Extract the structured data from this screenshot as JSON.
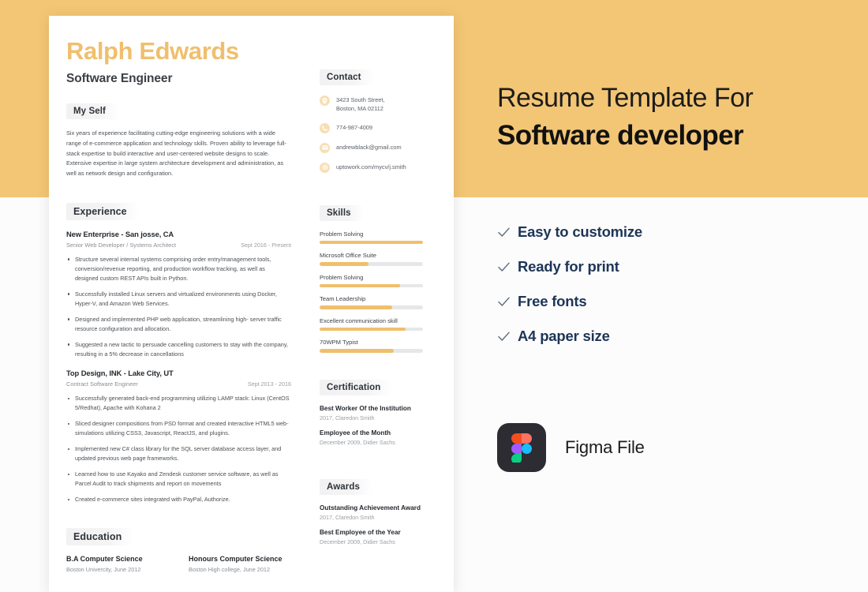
{
  "resume": {
    "name": "Ralph Edwards",
    "job_title": "Software Engineer",
    "sections": {
      "myself": "My Self",
      "experience": "Experience",
      "education": "Education",
      "contact": "Contact",
      "skills": "Skills",
      "certification": "Certification",
      "awards": "Awards"
    },
    "summary": "Six years of experience facilitating cutting-edge engineering solutions with a wide range of e-commerce application and technology skills. Proven ability to leverage full-stack expertise to build interactive and user-centered website designs to scale. Extensive expertise in large system architecture development and administration, as well as network design and configuration.",
    "jobs": [
      {
        "title": "New Enterprise - San josse, CA",
        "role": "Senior Web Developer / Systems Architect",
        "date": "Sept 2016 - Present",
        "bullets": [
          "Structure several internal systems comprising order entry/management tools, conversion/revenue reporting, and production workflow tracking, as well as designed custom REST APIs built in Python.",
          "Successfully installed Linux servers and virtualized environments using Docker, Hyper-V, and Amazon Web Services.",
          "Designed and implemented PHP web application, streamlining high- server traffic resource configuration and allocation.",
          "Suggested a new tactic to persuade cancelling customers to stay with the company, resulting in a 5% decrease in cancellations"
        ]
      },
      {
        "title": "Top Design, INK - Lake City, UT",
        "role": "Contract Software Engineer",
        "date": "Sept 2013 - 2016",
        "bullets": [
          "Successfully generated back-end programming utilizing LAMP stack: Linux (CentOS 5/Redhat), Apache with Kohana 2",
          "Sliced designer compositions from PSD format and created interactive HTML5 web-simulations utilizing CSS3, Javascript, ReactJS, and plugins.",
          "Implemented new C# class library for the SQL server database access layer, and updated previous web page frameworks.",
          "Learned how to use Kayako and Zendesk customer service software, as well as Parcel Audit to track shipments and report on movements",
          "Created e-commerce sites integrated with PayPal, Authorize."
        ]
      }
    ],
    "education": [
      {
        "degree": "B.A Computer Science",
        "sub": "Boston Univercity, June 2012"
      },
      {
        "degree": "Honours Computer Science",
        "sub": "Boston High college, June 2012"
      }
    ],
    "contact": [
      {
        "icon": "location-pin-icon",
        "text": "3423 South Street,\nBoston, MA 02112"
      },
      {
        "icon": "phone-icon",
        "text": "774-987-4009"
      },
      {
        "icon": "envelope-icon",
        "text": "andrewblack@gmail.com"
      },
      {
        "icon": "globe-icon",
        "text": "uptowork.com/mycv/j.smith"
      }
    ],
    "skills": [
      {
        "name": "Problem Solving",
        "level": 100
      },
      {
        "name": "Microsoft Office Suite",
        "level": 47
      },
      {
        "name": "Problem Solving",
        "level": 78
      },
      {
        "name": "Team Leadership",
        "level": 70
      },
      {
        "name": "Excellent communication skill",
        "level": 83
      },
      {
        "name": "70WPM Typist",
        "level": 72
      }
    ],
    "certifications": [
      {
        "title": "Best Worker Of the Institution",
        "sub": "2017, Claredon Smith"
      },
      {
        "title": "Employee of the Month",
        "sub": "December 2009, Didier Sachs"
      }
    ],
    "awards": [
      {
        "title": "Outstanding Achievement Award",
        "sub": "2017, Claredon Smith"
      },
      {
        "title": "Best Employee of the Year",
        "sub": "December 2009, Didier Sachs"
      }
    ]
  },
  "promo": {
    "title_line1": "Resume Template For",
    "title_line2": "Software developer",
    "features": [
      "Easy to customize",
      "Ready for print",
      "Free fonts",
      "A4 paper size"
    ],
    "figma_label": "Figma File"
  },
  "colors": {
    "accent_orange": "#f0bf6d",
    "band_orange": "#f3c675",
    "feature_navy": "#1d3557",
    "figma_dark": "#2c2c32"
  }
}
